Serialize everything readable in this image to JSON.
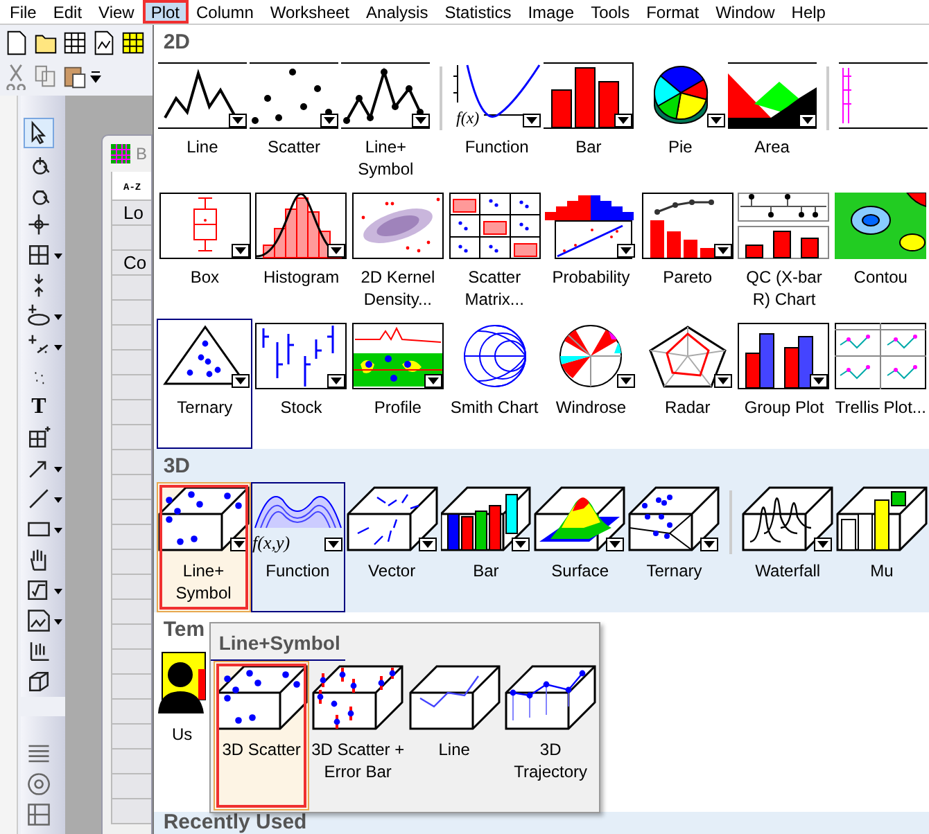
{
  "menubar": [
    {
      "label": "File",
      "selected": false,
      "annotated": false
    },
    {
      "label": "Edit",
      "selected": false,
      "annotated": false
    },
    {
      "label": "View",
      "selected": false,
      "annotated": false
    },
    {
      "label": "Plot",
      "selected": true,
      "annotated": true
    },
    {
      "label": "Column",
      "selected": false,
      "annotated": false
    },
    {
      "label": "Worksheet",
      "selected": false,
      "annotated": false
    },
    {
      "label": "Analysis",
      "selected": false,
      "annotated": false
    },
    {
      "label": "Statistics",
      "selected": false,
      "annotated": false
    },
    {
      "label": "Image",
      "selected": false,
      "annotated": false
    },
    {
      "label": "Tools",
      "selected": false,
      "annotated": false
    },
    {
      "label": "Format",
      "selected": false,
      "annotated": false
    },
    {
      "label": "Window",
      "selected": false,
      "annotated": false
    },
    {
      "label": "Help",
      "selected": false,
      "annotated": false
    }
  ],
  "toolbar": {
    "text_tool": "T"
  },
  "workbook": {
    "title": "B",
    "sort_label": "A-Z",
    "row_headers": [
      "Lo",
      "Co"
    ]
  },
  "gallery": {
    "sections": [
      {
        "title": "2D",
        "shaded": false,
        "rows": [
          [
            {
              "label": "Line",
              "kind": "line",
              "dropdown": true,
              "selected": false,
              "open": false,
              "annotated": false,
              "separator_before": false
            },
            {
              "label": "Scatter",
              "kind": "scatter",
              "dropdown": true,
              "selected": false,
              "open": false,
              "annotated": false,
              "separator_before": false
            },
            {
              "label": "Line+ Symbol",
              "kind": "linesymbol",
              "dropdown": true,
              "selected": false,
              "open": false,
              "annotated": false,
              "separator_before": false
            },
            {
              "label": "Function",
              "kind": "function",
              "icon_text": "f(x)",
              "dropdown": true,
              "selected": false,
              "open": false,
              "annotated": false,
              "separator_before": true
            },
            {
              "label": "Bar",
              "kind": "bar",
              "dropdown": true,
              "selected": false,
              "open": false,
              "annotated": false,
              "separator_before": false
            },
            {
              "label": "Pie",
              "kind": "pie",
              "dropdown": true,
              "selected": false,
              "open": false,
              "annotated": false,
              "separator_before": false
            },
            {
              "label": "Area",
              "kind": "area",
              "dropdown": true,
              "selected": false,
              "open": false,
              "annotated": false,
              "separator_before": false
            },
            {
              "kind": "multi",
              "dropdown": false,
              "selected": false,
              "open": false,
              "annotated": false,
              "separator_before": true
            }
          ],
          [
            {
              "label": "Box",
              "kind": "box",
              "dropdown": true,
              "selected": false,
              "open": false,
              "annotated": false,
              "separator_before": false
            },
            {
              "label": "Histogram",
              "kind": "histogram",
              "dropdown": true,
              "selected": false,
              "open": false,
              "annotated": false,
              "separator_before": false
            },
            {
              "label": "2D Kernel Density...",
              "kind": "kernel",
              "dropdown": false,
              "selected": false,
              "open": false,
              "annotated": false,
              "separator_before": false
            },
            {
              "label": "Scatter Matrix...",
              "kind": "matrix",
              "dropdown": false,
              "selected": false,
              "open": false,
              "annotated": false,
              "separator_before": false
            },
            {
              "label": "Probability",
              "kind": "probability",
              "dropdown": true,
              "selected": false,
              "open": false,
              "annotated": false,
              "separator_before": false
            },
            {
              "label": "Pareto",
              "kind": "pareto",
              "dropdown": true,
              "selected": false,
              "open": false,
              "annotated": false,
              "separator_before": false
            },
            {
              "label": "QC (X-bar R) Chart",
              "kind": "qc",
              "dropdown": false,
              "selected": false,
              "open": false,
              "annotated": false,
              "separator_before": false
            },
            {
              "label": "Contou",
              "kind": "contour",
              "dropdown": false,
              "selected": false,
              "open": false,
              "annotated": false,
              "separator_before": false
            }
          ],
          [
            {
              "label": "Ternary",
              "kind": "ternary",
              "dropdown": true,
              "selected": true,
              "open": false,
              "annotated": false,
              "separator_before": false
            },
            {
              "label": "Stock",
              "kind": "stock",
              "dropdown": true,
              "selected": false,
              "open": false,
              "annotated": false,
              "separator_before": false
            },
            {
              "label": "Profile",
              "kind": "profile",
              "dropdown": true,
              "selected": false,
              "open": false,
              "annotated": false,
              "separator_before": false
            },
            {
              "label": "Smith Chart",
              "kind": "smith",
              "dropdown": false,
              "selected": false,
              "open": false,
              "annotated": false,
              "separator_before": false
            },
            {
              "label": "Windrose",
              "kind": "windrose",
              "dropdown": true,
              "selected": false,
              "open": false,
              "annotated": false,
              "separator_before": false
            },
            {
              "label": "Radar",
              "kind": "radar",
              "dropdown": true,
              "selected": false,
              "open": false,
              "annotated": false,
              "separator_before": false
            },
            {
              "label": "Group Plot",
              "kind": "groupbar",
              "dropdown": true,
              "selected": false,
              "open": false,
              "annotated": false,
              "separator_before": false
            },
            {
              "label": "Trellis Plot...",
              "kind": "trellis",
              "dropdown": false,
              "selected": false,
              "open": false,
              "annotated": false,
              "separator_before": false
            }
          ]
        ]
      },
      {
        "title": "3D",
        "shaded": true,
        "rows": [
          [
            {
              "label": "Line+ Symbol",
              "kind": "scatter3d",
              "dropdown": true,
              "selected": false,
              "open": true,
              "annotated": true,
              "separator_before": false
            },
            {
              "label": "Function",
              "kind": "function3d",
              "icon_text": "f(x,y)",
              "dropdown": true,
              "selected": true,
              "open": false,
              "annotated": false,
              "separator_before": false
            },
            {
              "label": "Vector",
              "kind": "vector3d",
              "dropdown": true,
              "selected": false,
              "open": false,
              "annotated": false,
              "separator_before": false
            },
            {
              "label": "Bar",
              "kind": "bar3d",
              "dropdown": true,
              "selected": false,
              "open": false,
              "annotated": false,
              "separator_before": false
            },
            {
              "label": "Surface",
              "kind": "surface3d",
              "dropdown": true,
              "selected": false,
              "open": false,
              "annotated": false,
              "separator_before": false
            },
            {
              "label": "Ternary",
              "kind": "ternary3d",
              "dropdown": true,
              "selected": false,
              "open": false,
              "annotated": false,
              "separator_before": false
            },
            {
              "label": "Waterfall",
              "kind": "waterfall3d",
              "dropdown": true,
              "selected": false,
              "open": false,
              "annotated": false,
              "separator_before": true
            },
            {
              "label": "Mu",
              "kind": "multi3d",
              "dropdown": false,
              "selected": false,
              "open": false,
              "annotated": false,
              "separator_before": false
            }
          ]
        ]
      },
      {
        "title": "Tem",
        "shaded": false,
        "rows": [
          [
            {
              "label": "Us",
              "kind": "user",
              "dropdown": false,
              "selected": false,
              "open": false,
              "annotated": false,
              "separator_before": false
            }
          ]
        ]
      },
      {
        "title": "Recently Used",
        "shaded": true
      }
    ]
  },
  "submenu": {
    "title": "Line+Symbol",
    "items": [
      {
        "label": "3D Scatter",
        "kind": "scatter3d",
        "selected": true,
        "annotated": true
      },
      {
        "label": "3D Scatter + Error Bar",
        "kind": "errorbar3d",
        "selected": false,
        "annotated": false
      },
      {
        "label": "Line",
        "kind": "line3d",
        "selected": false,
        "annotated": false
      },
      {
        "label": "3D Trajectory",
        "kind": "trajectory3d",
        "selected": false,
        "annotated": false
      }
    ]
  }
}
